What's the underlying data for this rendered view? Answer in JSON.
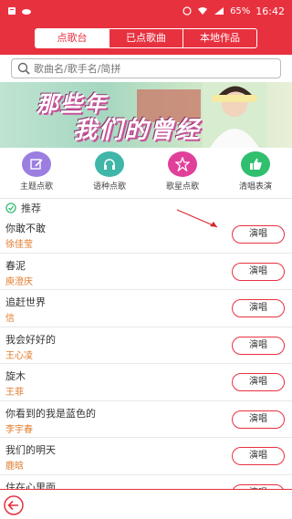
{
  "status_bar": {
    "battery": "65%",
    "time": "16:42"
  },
  "tabs": [
    {
      "label": "点歌台",
      "active": true
    },
    {
      "label": "已点歌曲",
      "active": false
    },
    {
      "label": "本地作品",
      "active": false
    }
  ],
  "search": {
    "placeholder": "歌曲名/歌手名/简拼"
  },
  "banner": {
    "line1": "那些年",
    "line2": "我们的曾经"
  },
  "categories": [
    {
      "label": "主题点歌",
      "icon": "edit-icon",
      "color": "#9b7ee0"
    },
    {
      "label": "语种点歌",
      "icon": "headphones-icon",
      "color": "#3fb6a8"
    },
    {
      "label": "歌星点歌",
      "icon": "star-icon",
      "color": "#e0409a"
    },
    {
      "label": "清唱表演",
      "icon": "thumbs-up-icon",
      "color": "#2fbf6f"
    }
  ],
  "section": {
    "title": "推荐"
  },
  "songs": [
    {
      "title": "你敢不敢",
      "artist": "徐佳莹",
      "button": "演唱"
    },
    {
      "title": "春泥",
      "artist": "庾澄庆",
      "button": "演唱"
    },
    {
      "title": "追赶世界",
      "artist": "信",
      "button": "演唱"
    },
    {
      "title": "我会好好的",
      "artist": "王心凌",
      "button": "演唱"
    },
    {
      "title": "旋木",
      "artist": "王菲",
      "button": "演唱"
    },
    {
      "title": "你看到的我是蓝色的",
      "artist": "李宇春",
      "button": "演唱"
    },
    {
      "title": "我们的明天",
      "artist": "鹿晗",
      "button": "演唱"
    },
    {
      "title": "住在心里面",
      "artist": "",
      "button": "演唱"
    }
  ],
  "colors": {
    "accent": "#e8313f",
    "artist": "#e07a2b"
  }
}
